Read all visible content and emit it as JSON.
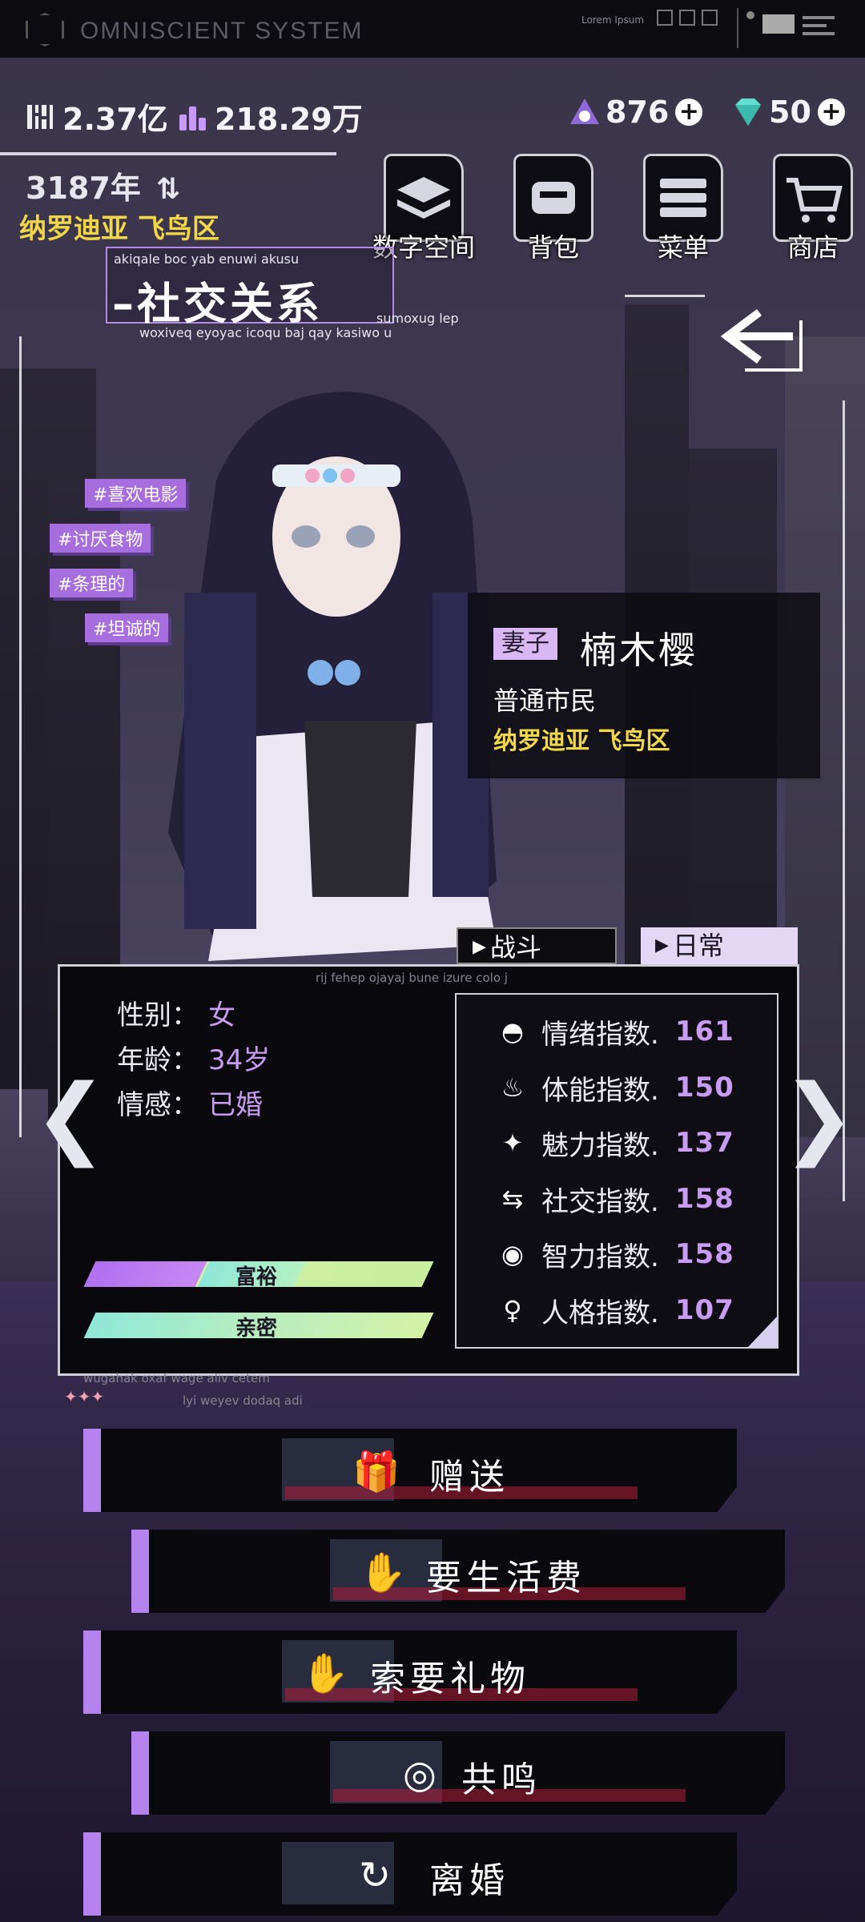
{
  "system": {
    "title": "OMNISCIENT SYSTEM",
    "lorem": "Lorem Ipsum"
  },
  "currency": {
    "money1": "2.37亿",
    "money2": "218.29万",
    "points": "876",
    "gems": "50"
  },
  "time": {
    "year": "3187年",
    "location": "纳罗迪亚 飞鸟区"
  },
  "menu": [
    {
      "label": "数字空间",
      "icon": "layers-icon"
    },
    {
      "label": "背包",
      "icon": "backpack-icon"
    },
    {
      "label": "菜单",
      "icon": "list-icon"
    },
    {
      "label": "商店",
      "icon": "cart-icon"
    }
  ],
  "section": {
    "title": "社交关系",
    "tiny_top": "akiqale boc yab enuwi akusu",
    "tiny_bottom": "woxiveq eyoyac icoqu baj qay kasiwo u",
    "tiny_right": "sumoxug lep"
  },
  "tags": [
    "#喜欢电影",
    "#讨厌食物",
    "#条理的",
    "#坦诚的"
  ],
  "character": {
    "relation": "妻子",
    "name": "楠木樱",
    "status": "普通市民",
    "location": "纳罗迪亚 飞鸟区"
  },
  "tabs": {
    "battle": "战斗",
    "daily": "日常",
    "caption": "rij fehep ojayaj bune izure colo j"
  },
  "profile": {
    "gender_label": "性别：",
    "gender": "女",
    "age_label": "年龄：",
    "age": "34岁",
    "emotion_label": "情感：",
    "emotion": "已婚",
    "bars": [
      {
        "label": "富裕",
        "fill": 0.33
      },
      {
        "label": "亲密",
        "fill": 0.0
      }
    ],
    "micro1": "wugahak oxaf wage aliv cetem",
    "micro2": "lyi weyev dodaq adi"
  },
  "stats": [
    {
      "icon": "mood-icon",
      "name": "情绪指数.",
      "value": "161"
    },
    {
      "icon": "fitness-icon",
      "name": "体能指数.",
      "value": "150"
    },
    {
      "icon": "sparkle-icon",
      "name": "魅力指数.",
      "value": "137"
    },
    {
      "icon": "social-icon",
      "name": "社交指数.",
      "value": "158"
    },
    {
      "icon": "eye-icon",
      "name": "智力指数.",
      "value": "158"
    },
    {
      "icon": "person-icon",
      "name": "人格指数.",
      "value": "107"
    }
  ],
  "actions": [
    {
      "label": "赠送",
      "icon": "gift-icon"
    },
    {
      "label": "要生活费",
      "icon": "money-hand-icon"
    },
    {
      "label": "索要礼物",
      "icon": "gift-hand-icon"
    },
    {
      "label": "共鸣",
      "icon": "resonance-eye-icon"
    },
    {
      "label": "离婚",
      "icon": "divorce-icon"
    }
  ],
  "colors": {
    "accent": "#b483ee",
    "gold": "#f2d64a",
    "value": "#c89cf2",
    "bar_purple": "#b070f0",
    "bar_mint": "#8fe8d8",
    "bar_lime": "#d4f2a6"
  }
}
